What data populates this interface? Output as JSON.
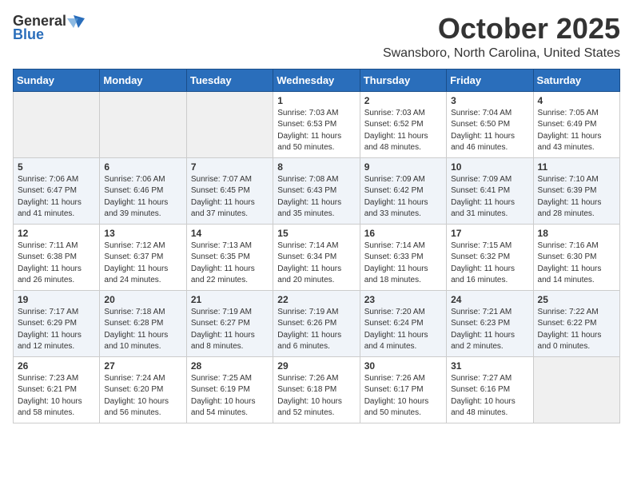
{
  "logo": {
    "general": "General",
    "blue": "Blue"
  },
  "title": "October 2025",
  "location": "Swansboro, North Carolina, United States",
  "days_of_week": [
    "Sunday",
    "Monday",
    "Tuesday",
    "Wednesday",
    "Thursday",
    "Friday",
    "Saturday"
  ],
  "weeks": [
    [
      {
        "day": "",
        "content": ""
      },
      {
        "day": "",
        "content": ""
      },
      {
        "day": "",
        "content": ""
      },
      {
        "day": "1",
        "content": "Sunrise: 7:03 AM\nSunset: 6:53 PM\nDaylight: 11 hours and 50 minutes."
      },
      {
        "day": "2",
        "content": "Sunrise: 7:03 AM\nSunset: 6:52 PM\nDaylight: 11 hours and 48 minutes."
      },
      {
        "day": "3",
        "content": "Sunrise: 7:04 AM\nSunset: 6:50 PM\nDaylight: 11 hours and 46 minutes."
      },
      {
        "day": "4",
        "content": "Sunrise: 7:05 AM\nSunset: 6:49 PM\nDaylight: 11 hours and 43 minutes."
      }
    ],
    [
      {
        "day": "5",
        "content": "Sunrise: 7:06 AM\nSunset: 6:47 PM\nDaylight: 11 hours and 41 minutes."
      },
      {
        "day": "6",
        "content": "Sunrise: 7:06 AM\nSunset: 6:46 PM\nDaylight: 11 hours and 39 minutes."
      },
      {
        "day": "7",
        "content": "Sunrise: 7:07 AM\nSunset: 6:45 PM\nDaylight: 11 hours and 37 minutes."
      },
      {
        "day": "8",
        "content": "Sunrise: 7:08 AM\nSunset: 6:43 PM\nDaylight: 11 hours and 35 minutes."
      },
      {
        "day": "9",
        "content": "Sunrise: 7:09 AM\nSunset: 6:42 PM\nDaylight: 11 hours and 33 minutes."
      },
      {
        "day": "10",
        "content": "Sunrise: 7:09 AM\nSunset: 6:41 PM\nDaylight: 11 hours and 31 minutes."
      },
      {
        "day": "11",
        "content": "Sunrise: 7:10 AM\nSunset: 6:39 PM\nDaylight: 11 hours and 28 minutes."
      }
    ],
    [
      {
        "day": "12",
        "content": "Sunrise: 7:11 AM\nSunset: 6:38 PM\nDaylight: 11 hours and 26 minutes."
      },
      {
        "day": "13",
        "content": "Sunrise: 7:12 AM\nSunset: 6:37 PM\nDaylight: 11 hours and 24 minutes."
      },
      {
        "day": "14",
        "content": "Sunrise: 7:13 AM\nSunset: 6:35 PM\nDaylight: 11 hours and 22 minutes."
      },
      {
        "day": "15",
        "content": "Sunrise: 7:14 AM\nSunset: 6:34 PM\nDaylight: 11 hours and 20 minutes."
      },
      {
        "day": "16",
        "content": "Sunrise: 7:14 AM\nSunset: 6:33 PM\nDaylight: 11 hours and 18 minutes."
      },
      {
        "day": "17",
        "content": "Sunrise: 7:15 AM\nSunset: 6:32 PM\nDaylight: 11 hours and 16 minutes."
      },
      {
        "day": "18",
        "content": "Sunrise: 7:16 AM\nSunset: 6:30 PM\nDaylight: 11 hours and 14 minutes."
      }
    ],
    [
      {
        "day": "19",
        "content": "Sunrise: 7:17 AM\nSunset: 6:29 PM\nDaylight: 11 hours and 12 minutes."
      },
      {
        "day": "20",
        "content": "Sunrise: 7:18 AM\nSunset: 6:28 PM\nDaylight: 11 hours and 10 minutes."
      },
      {
        "day": "21",
        "content": "Sunrise: 7:19 AM\nSunset: 6:27 PM\nDaylight: 11 hours and 8 minutes."
      },
      {
        "day": "22",
        "content": "Sunrise: 7:19 AM\nSunset: 6:26 PM\nDaylight: 11 hours and 6 minutes."
      },
      {
        "day": "23",
        "content": "Sunrise: 7:20 AM\nSunset: 6:24 PM\nDaylight: 11 hours and 4 minutes."
      },
      {
        "day": "24",
        "content": "Sunrise: 7:21 AM\nSunset: 6:23 PM\nDaylight: 11 hours and 2 minutes."
      },
      {
        "day": "25",
        "content": "Sunrise: 7:22 AM\nSunset: 6:22 PM\nDaylight: 11 hours and 0 minutes."
      }
    ],
    [
      {
        "day": "26",
        "content": "Sunrise: 7:23 AM\nSunset: 6:21 PM\nDaylight: 10 hours and 58 minutes."
      },
      {
        "day": "27",
        "content": "Sunrise: 7:24 AM\nSunset: 6:20 PM\nDaylight: 10 hours and 56 minutes."
      },
      {
        "day": "28",
        "content": "Sunrise: 7:25 AM\nSunset: 6:19 PM\nDaylight: 10 hours and 54 minutes."
      },
      {
        "day": "29",
        "content": "Sunrise: 7:26 AM\nSunset: 6:18 PM\nDaylight: 10 hours and 52 minutes."
      },
      {
        "day": "30",
        "content": "Sunrise: 7:26 AM\nSunset: 6:17 PM\nDaylight: 10 hours and 50 minutes."
      },
      {
        "day": "31",
        "content": "Sunrise: 7:27 AM\nSunset: 6:16 PM\nDaylight: 10 hours and 48 minutes."
      },
      {
        "day": "",
        "content": ""
      }
    ]
  ]
}
